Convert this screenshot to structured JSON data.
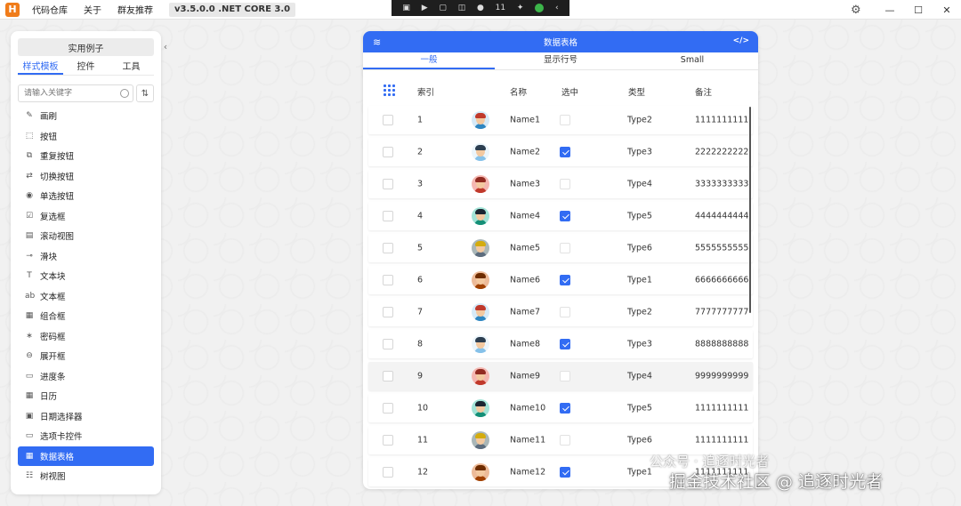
{
  "app": {
    "logo_letter": "H",
    "menu": [
      "代码仓库",
      "关于",
      "群友推荐"
    ],
    "version": "v3.5.0.0 .NET CORE 3.0",
    "capture_count": "11"
  },
  "sidebar": {
    "examples_label": "实用例子",
    "tabs": [
      "样式模板",
      "控件",
      "工具"
    ],
    "active_tab": "样式模板",
    "search_placeholder": "请输入关键字",
    "items": [
      {
        "label": "画刷",
        "icon": "brush-icon",
        "glyph": "✎"
      },
      {
        "label": "按钮",
        "icon": "button-icon",
        "glyph": "⬚"
      },
      {
        "label": "重复按钮",
        "icon": "repeat-button-icon",
        "glyph": "⧉"
      },
      {
        "label": "切换按钮",
        "icon": "toggle-button-icon",
        "glyph": "⇄"
      },
      {
        "label": "单选按钮",
        "icon": "radio-icon",
        "glyph": "◉"
      },
      {
        "label": "复选框",
        "icon": "checkbox-icon",
        "glyph": "☑"
      },
      {
        "label": "滚动视图",
        "icon": "scroll-view-icon",
        "glyph": "▤"
      },
      {
        "label": "滑块",
        "icon": "slider-icon",
        "glyph": "⊸"
      },
      {
        "label": "文本块",
        "icon": "text-block-icon",
        "glyph": "T"
      },
      {
        "label": "文本框",
        "icon": "text-box-icon",
        "glyph": "ab"
      },
      {
        "label": "组合框",
        "icon": "combo-box-icon",
        "glyph": "▦"
      },
      {
        "label": "密码框",
        "icon": "password-box-icon",
        "glyph": "∗"
      },
      {
        "label": "展开框",
        "icon": "expander-icon",
        "glyph": "⊖"
      },
      {
        "label": "进度条",
        "icon": "progress-bar-icon",
        "glyph": "▭"
      },
      {
        "label": "日历",
        "icon": "calendar-icon",
        "glyph": "▦"
      },
      {
        "label": "日期选择器",
        "icon": "date-picker-icon",
        "glyph": "▣"
      },
      {
        "label": "选项卡控件",
        "icon": "tab-control-icon",
        "glyph": "▭"
      },
      {
        "label": "数据表格",
        "icon": "data-grid-icon",
        "glyph": "▦"
      },
      {
        "label": "树视图",
        "icon": "tree-view-icon",
        "glyph": "☷"
      }
    ],
    "active_item": "数据表格"
  },
  "card": {
    "title": "数据表格",
    "tabs": [
      "一般",
      "显示行号",
      "Small"
    ],
    "active_tab": "一般",
    "columns": {
      "index": "索引",
      "name": "名称",
      "selected": "选中",
      "type": "类型",
      "remark": "备注"
    },
    "rows": [
      {
        "index": "1",
        "name": "Name1",
        "selected": false,
        "type": "Type2",
        "remark": "1111111111",
        "avatar": {
          "hair": "#c0392b",
          "body": "#2e86c1",
          "bg": "#d6eaf8"
        }
      },
      {
        "index": "2",
        "name": "Name2",
        "selected": true,
        "type": "Type3",
        "remark": "2222222222",
        "avatar": {
          "hair": "#2c3e50",
          "body": "#85c1e9",
          "bg": "#ebf5fb"
        }
      },
      {
        "index": "3",
        "name": "Name3",
        "selected": false,
        "type": "Type4",
        "remark": "3333333333",
        "avatar": {
          "hair": "#922b21",
          "body": "#c0392b",
          "bg": "#f5b7b1"
        }
      },
      {
        "index": "4",
        "name": "Name4",
        "selected": true,
        "type": "Type5",
        "remark": "4444444444",
        "avatar": {
          "hair": "#1b2631",
          "body": "#148f77",
          "bg": "#a3e4d7"
        }
      },
      {
        "index": "5",
        "name": "Name5",
        "selected": false,
        "type": "Type6",
        "remark": "5555555555",
        "avatar": {
          "hair": "#d4ac0d",
          "body": "#5d6d7e",
          "bg": "#aab7b8"
        }
      },
      {
        "index": "6",
        "name": "Name6",
        "selected": true,
        "type": "Type1",
        "remark": "6666666666",
        "avatar": {
          "hair": "#6e2c00",
          "body": "#a04000",
          "bg": "#edbb99"
        }
      },
      {
        "index": "7",
        "name": "Name7",
        "selected": false,
        "type": "Type2",
        "remark": "7777777777",
        "avatar": {
          "hair": "#c0392b",
          "body": "#2e86c1",
          "bg": "#d6eaf8"
        }
      },
      {
        "index": "8",
        "name": "Name8",
        "selected": true,
        "type": "Type3",
        "remark": "8888888888",
        "avatar": {
          "hair": "#2c3e50",
          "body": "#85c1e9",
          "bg": "#ebf5fb"
        }
      },
      {
        "index": "9",
        "name": "Name9",
        "selected": false,
        "type": "Type4",
        "remark": "9999999999",
        "avatar": {
          "hair": "#922b21",
          "body": "#c0392b",
          "bg": "#f5b7b1"
        }
      },
      {
        "index": "10",
        "name": "Name10",
        "selected": true,
        "type": "Type5",
        "remark": "1111111111",
        "avatar": {
          "hair": "#1b2631",
          "body": "#148f77",
          "bg": "#a3e4d7"
        }
      },
      {
        "index": "11",
        "name": "Name11",
        "selected": false,
        "type": "Type6",
        "remark": "1111111111",
        "avatar": {
          "hair": "#d4ac0d",
          "body": "#5d6d7e",
          "bg": "#aab7b8"
        }
      },
      {
        "index": "12",
        "name": "Name12",
        "selected": true,
        "type": "Type1",
        "remark": "1111111111",
        "avatar": {
          "hair": "#6e2c00",
          "body": "#a04000",
          "bg": "#edbb99"
        }
      }
    ]
  },
  "watermarks": [
    "公众号 · 追逐时光者",
    "掘金技术社区 @ 追逐时光者"
  ],
  "colors": {
    "accent": "#326cf3",
    "logo": "#f07c1a"
  }
}
